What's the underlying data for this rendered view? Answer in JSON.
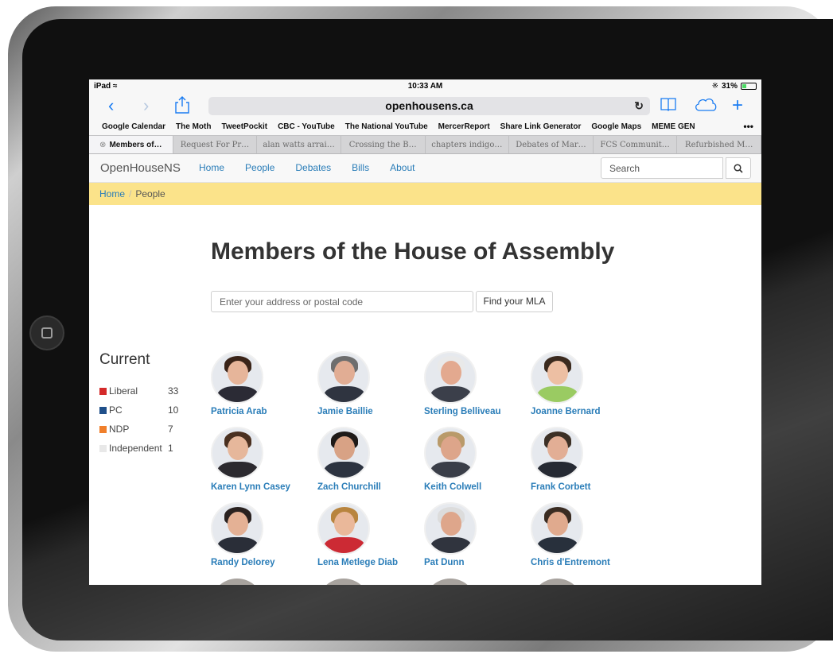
{
  "status": {
    "device": "iPad",
    "time": "10:33 AM",
    "battery": "31%"
  },
  "browser": {
    "url": "openhousens.ca",
    "bookmarks": [
      "Google Calendar",
      "The Moth",
      "TweetPockit",
      "CBC - YouTube",
      "The National YouTube",
      "MercerReport",
      "Share Link Generator",
      "Google Maps",
      "MEME GEN"
    ],
    "more": "•••",
    "tabs": [
      "Members of…",
      "Request For Pr…",
      "alan watts arrai…",
      "Crossing the B…",
      "chapters indigo…",
      "Debates of Mar…",
      "FCS Communit…",
      "Refurbished M…"
    ]
  },
  "site": {
    "brand": "OpenHouseNS",
    "nav": [
      "Home",
      "People",
      "Debates",
      "Bills",
      "About"
    ],
    "search_placeholder": "Search"
  },
  "breadcrumb": {
    "home": "Home",
    "sep": "/",
    "current": "People"
  },
  "main": {
    "title": "Members of the House of Assembly",
    "address_placeholder": "Enter your address or postal code",
    "find_button": "Find your MLA"
  },
  "sidebar": {
    "heading": "Current",
    "parties": [
      {
        "name": "Liberal",
        "count": "33",
        "color": "#d42a2a"
      },
      {
        "name": "PC",
        "count": "10",
        "color": "#1f4f8a"
      },
      {
        "name": "NDP",
        "count": "7",
        "color": "#f07f2b"
      },
      {
        "name": "Independent",
        "count": "1",
        "color": "#e8e8e8"
      }
    ]
  },
  "people": [
    {
      "name": "Patricia Arab",
      "hair": "#3a2418",
      "skin": "#e6b59a",
      "shirt": "#2b2b35"
    },
    {
      "name": "Jamie Baillie",
      "hair": "#6e6e6e",
      "skin": "#e1ad94",
      "shirt": "#2f3440"
    },
    {
      "name": "Sterling Belliveau",
      "hair": "#e9e9e9",
      "skin": "#e3a98f",
      "shirt": "#3b3f4a"
    },
    {
      "name": "Joanne Bernard",
      "hair": "#3b2a1e",
      "skin": "#edbfa3",
      "shirt": "#9acb62"
    },
    {
      "name": "Karen Lynn Casey",
      "hair": "#4a3020",
      "skin": "#e6b79b",
      "shirt": "#2c2a2f"
    },
    {
      "name": "Zach Churchill",
      "hair": "#1e1a18",
      "skin": "#d8a285",
      "shirt": "#2c3340"
    },
    {
      "name": "Keith Colwell",
      "hair": "#b99a6a",
      "skin": "#dda58a",
      "shirt": "#3a3e48"
    },
    {
      "name": "Frank Corbett",
      "hair": "#3c3026",
      "skin": "#e2ae95",
      "shirt": "#262a33"
    },
    {
      "name": "Randy Delorey",
      "hair": "#2a2220",
      "skin": "#e4b195",
      "shirt": "#2a2e38"
    },
    {
      "name": "Lena Metlege Diab",
      "hair": "#b8843e",
      "skin": "#eab89a",
      "shirt": "#cc2a34"
    },
    {
      "name": "Pat Dunn",
      "hair": "#dcdcdc",
      "skin": "#dea68b",
      "shirt": "#30343e"
    },
    {
      "name": "Chris d'Entremont",
      "hair": "#3a2c22",
      "skin": "#e0aa8e",
      "shirt": "#28303c"
    }
  ]
}
